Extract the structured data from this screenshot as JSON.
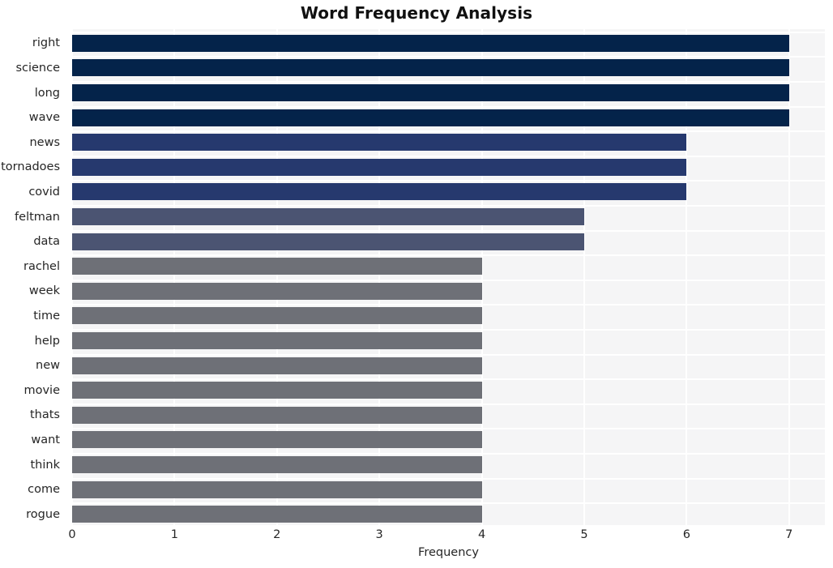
{
  "chart_data": {
    "type": "bar",
    "orientation": "horizontal",
    "title": "Word Frequency Analysis",
    "xlabel": "Frequency",
    "ylabel": "",
    "categories": [
      "right",
      "science",
      "long",
      "wave",
      "news",
      "tornadoes",
      "covid",
      "feltman",
      "data",
      "rachel",
      "week",
      "time",
      "help",
      "new",
      "movie",
      "thats",
      "want",
      "think",
      "come",
      "rogue"
    ],
    "values": [
      7,
      7,
      7,
      7,
      6,
      6,
      6,
      5,
      5,
      4,
      4,
      4,
      4,
      4,
      4,
      4,
      4,
      4,
      4,
      4
    ],
    "xlim": [
      0,
      7.35
    ],
    "xticks": [
      "0",
      "1",
      "2",
      "3",
      "4",
      "5",
      "6",
      "7"
    ],
    "xtick_values": [
      0,
      1,
      2,
      3,
      4,
      5,
      6,
      7
    ],
    "grid": true,
    "grid_color": "#ffffff",
    "legend": "none",
    "plot_background": "#f5f5f6",
    "figure_background": "#ffffff",
    "bar_colors": [
      "#04234a",
      "#04234a",
      "#04234a",
      "#04234a",
      "#26396e",
      "#26396e",
      "#26396e",
      "#4b5472",
      "#4b5472",
      "#6e7077",
      "#6e7077",
      "#6e7077",
      "#6e7077",
      "#6e7077",
      "#6e7077",
      "#6e7077",
      "#6e7077",
      "#6e7077",
      "#6e7077",
      "#6e7077"
    ],
    "palette": {
      "value_7": "#04234a",
      "value_6": "#26396e",
      "value_5": "#4b5472",
      "value_4": "#6e7077"
    },
    "text_color": "#262626",
    "title_color": "#111111"
  }
}
